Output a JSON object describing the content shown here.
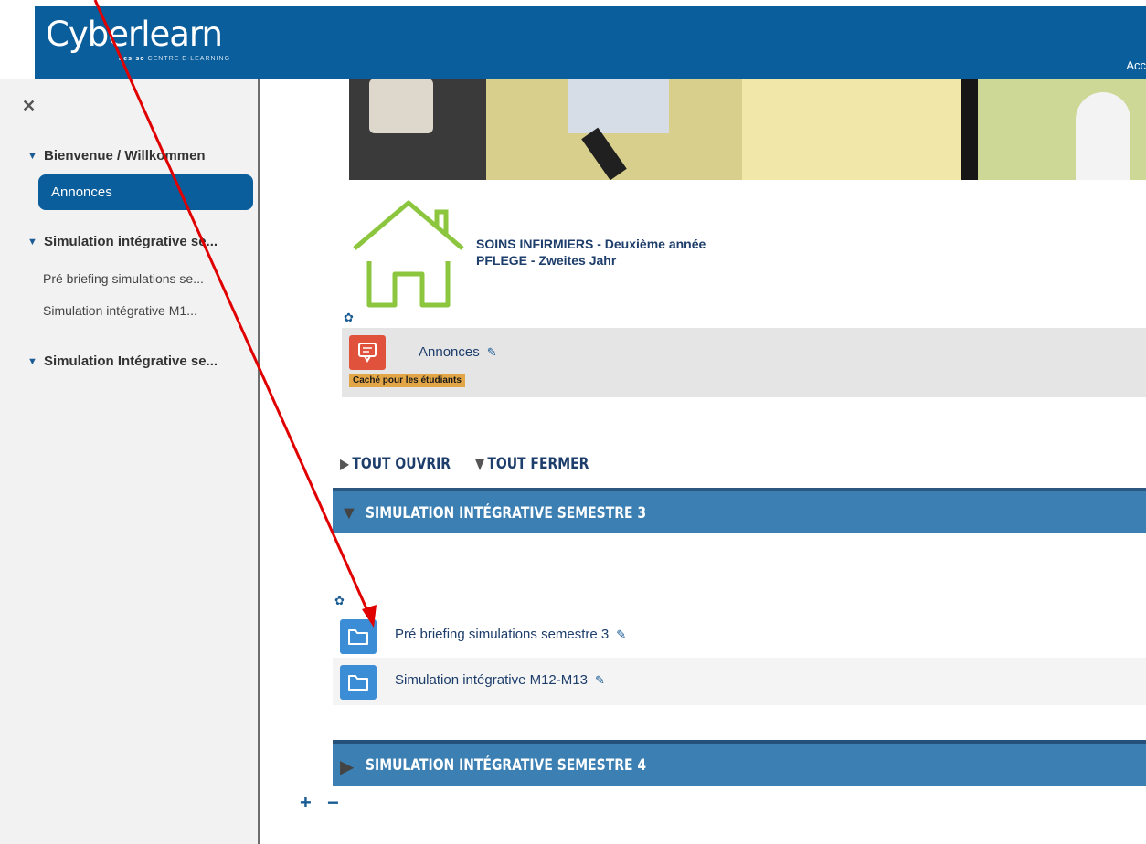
{
  "brand": {
    "name": "Cyberlearn",
    "sub_bold": "hes·so",
    "sub": "CENTRE E-LEARNING"
  },
  "header": {
    "right_text": "Acc"
  },
  "sidebar": {
    "close_icon": "close-icon",
    "sections": [
      {
        "label": "Bienvenue / Willkommen"
      },
      {
        "label": "Simulation intégrative se..."
      },
      {
        "label": "Simulation Intégrative se..."
      }
    ],
    "active_item": "Annonces",
    "items": [
      {
        "label": "Pré briefing simulations se..."
      },
      {
        "label": "Simulation intégrative M1..."
      }
    ]
  },
  "course": {
    "title_line1": "SOINS INFIRMIERS - Deuxième année",
    "title_line2": "PFLEGE - Zweites Jahr"
  },
  "announcements": {
    "label": "Annonces",
    "badge": "Caché pour les étudiants",
    "icon": "chat-icon"
  },
  "controls": {
    "open_all": "TOUT OUVRIR",
    "close_all": "TOUT FERMER"
  },
  "sections": [
    {
      "title": "SIMULATION INTÉGRATIVE SEMESTRE 3",
      "expanded": true,
      "activities": [
        {
          "label": "Pré briefing simulations semestre 3",
          "icon": "folder-icon"
        },
        {
          "label": "Simulation intégrative M12-M13",
          "icon": "folder-icon"
        }
      ]
    },
    {
      "title": "SIMULATION INTÉGRATIVE SEMESTRE 4",
      "expanded": false
    }
  ],
  "footer": {
    "plus": "+",
    "minus": "−"
  },
  "colors": {
    "brand_blue": "#0b5e9c",
    "section_blue": "#3b7fb3",
    "folder_blue": "#3b8ed6",
    "announce_red": "#e1523d",
    "badge_orange": "#e3a647",
    "house_green": "#8cc63f",
    "arrow_red": "#e00000"
  }
}
